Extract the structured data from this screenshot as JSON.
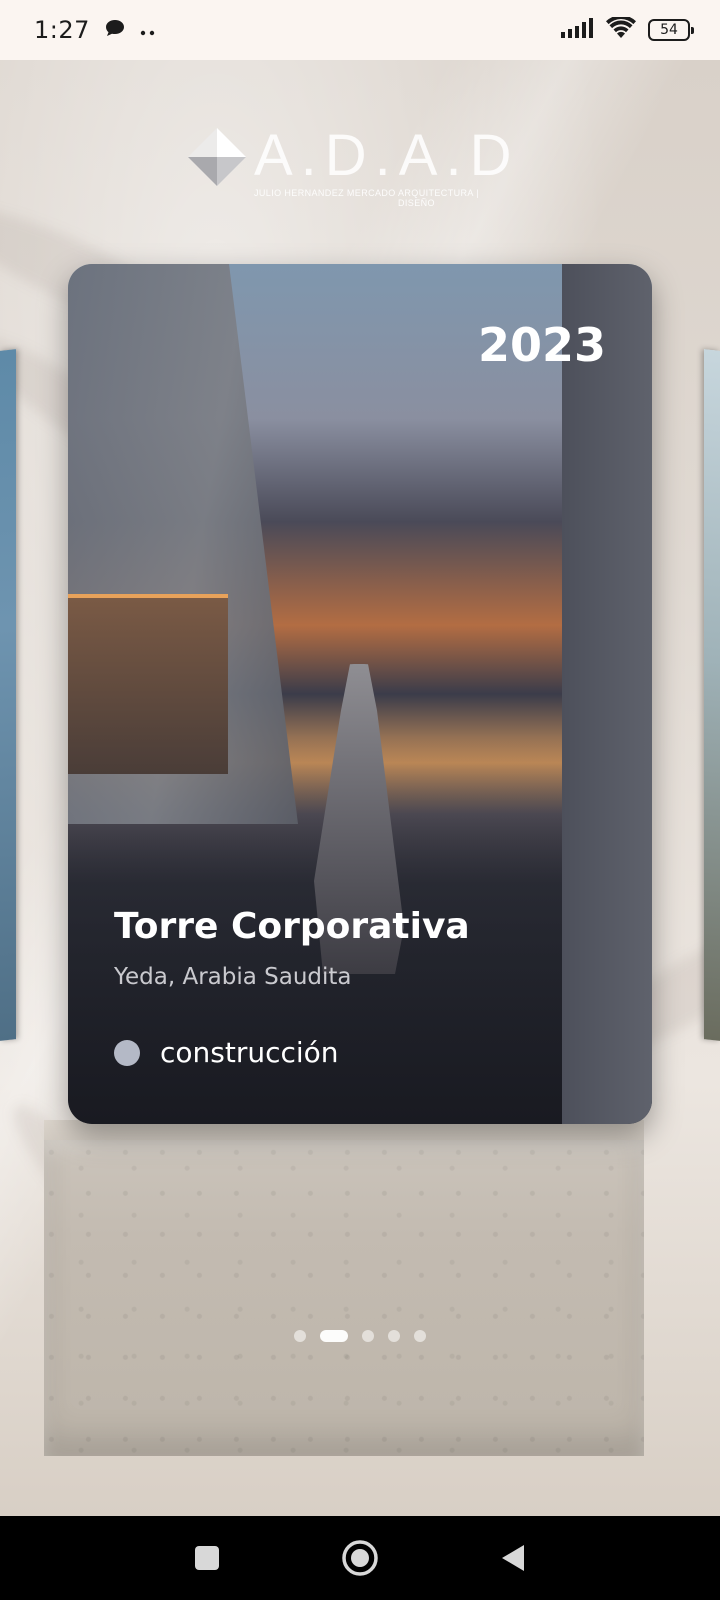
{
  "status_bar": {
    "time": "1:27",
    "battery": "54",
    "icons": [
      "chat-bubble-icon",
      "more-dots-icon",
      "signal-icon",
      "wifi-icon",
      "battery-icon"
    ]
  },
  "logo": {
    "mark": "A.D.A.D",
    "left_caption": "JULIO HERNANDEZ MERCADO",
    "right_caption": "ARQUITECTURA | DISEÑO"
  },
  "card": {
    "year": "2023",
    "title": "Torre Corporativa",
    "location": "Yeda, Arabia Saudita",
    "status": "construcción",
    "status_color": "#b4b9c6"
  },
  "pager": {
    "count": 5,
    "active_index": 1
  },
  "nav_bar": {
    "buttons": [
      "recents-square-icon",
      "home-circle-icon",
      "back-triangle-icon"
    ]
  }
}
